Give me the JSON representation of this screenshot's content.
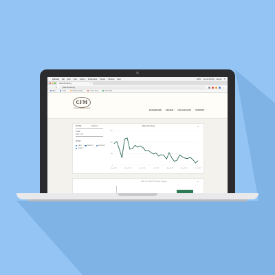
{
  "menubar": {
    "apple": "",
    "items": [
      "Chrome",
      "File",
      "Edit",
      "View",
      "History",
      "Bookmarks",
      "People",
      "Window",
      "Help"
    ],
    "right": [
      "100%",
      "Tue 11:35 PM",
      "Search",
      "☰"
    ]
  },
  "browser": {
    "tab_title": "www.cfm-ark.org",
    "url": "www.cfm-ark.org",
    "bookmarks": [
      "Apps",
      "Trello",
      "Google Analytics",
      "Cmeta Trend",
      "Sheet Shift"
    ]
  },
  "site": {
    "logo_text": "CFM",
    "logo_sub": "CITIZENS FOR MODERN TRANSIT",
    "nav": [
      "DASHBOARD",
      "GRAPHS",
      "UPLOAD DATA",
      "SUPPORT"
    ]
  },
  "panel": {
    "route_label": "ROUTE",
    "route_value": "OVERLAY",
    "stop_label": "STOP",
    "stop_value": "APR 1 TO",
    "group_label": "SHOW",
    "radios": [
      {
        "label": "DAILY",
        "on": true
      },
      {
        "label": "WEEKLY",
        "on": false
      },
      {
        "label": "MONTHLY",
        "on": false
      },
      {
        "label": "YEARLY",
        "on": false
      }
    ]
  },
  "chart_data": {
    "type": "line",
    "title": "Riders Per Week",
    "x_ticks": [
      "Apr 2019",
      "May 2019",
      "Jun 2019",
      "Jul 2019",
      "Aug 2019",
      "Sep 2019",
      "Oct 2019"
    ],
    "y_ticks": [
      "15K",
      "10K",
      "5K",
      "0"
    ],
    "ylim": [
      0,
      15000
    ],
    "values": [
      9400,
      10200,
      6800,
      3200,
      11300,
      11800,
      6900,
      7200,
      8600,
      7800,
      8300,
      7600,
      6200,
      6400,
      5500,
      4800,
      5200,
      3900,
      4500,
      4200,
      2600,
      5400,
      3100,
      1600,
      2100,
      4400,
      3600,
      3000,
      2800,
      3400,
      2400,
      900,
      1800
    ],
    "color": "#2e6b50",
    "grid": true
  },
  "chart2": {
    "title": "Riders Per Week Per Station Category",
    "bar_color": "#2e7a56"
  }
}
